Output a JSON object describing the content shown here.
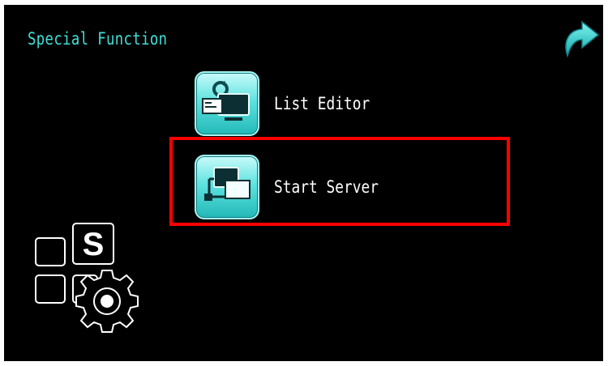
{
  "header": {
    "title": "Special Function"
  },
  "menu": {
    "items": [
      {
        "label": "List Editor",
        "icon": "list-editor-icon"
      },
      {
        "label": "Start Server",
        "icon": "start-server-icon"
      }
    ]
  },
  "logo": {
    "letter": "S"
  },
  "colors": {
    "title": "#3fe0d8",
    "accent": "#22b8b7",
    "highlight": "#ff0000",
    "background": "#000000"
  }
}
